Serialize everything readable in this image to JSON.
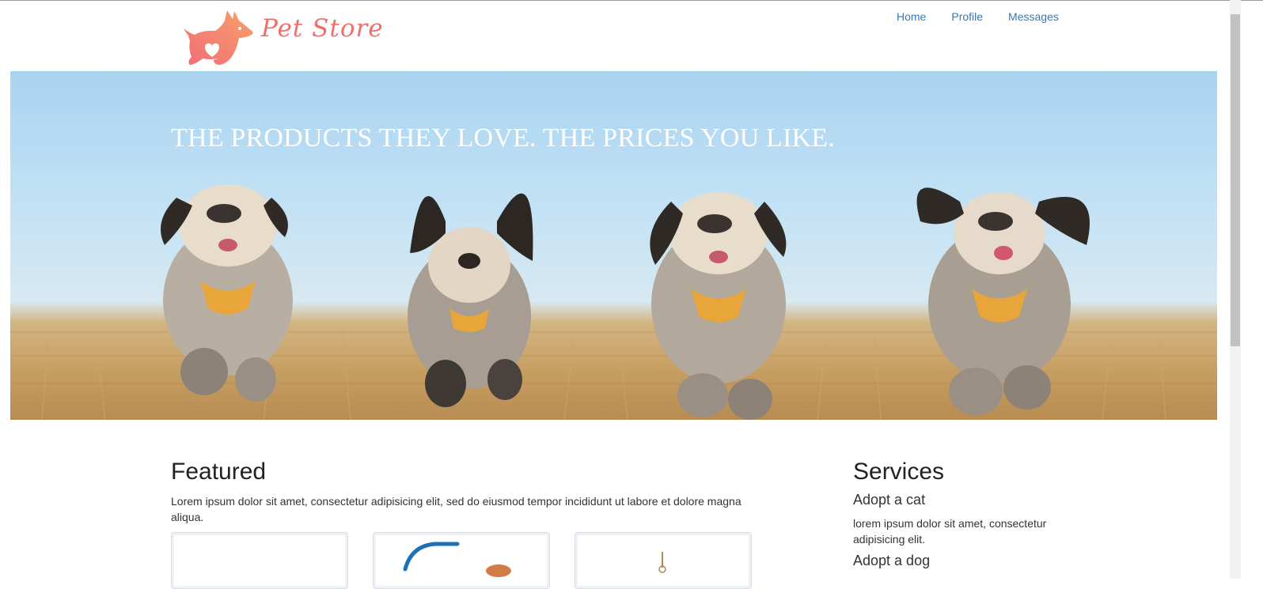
{
  "header": {
    "brand": "Pet Store",
    "nav": [
      "Home",
      "Profile",
      "Messages"
    ]
  },
  "hero": {
    "headline": "THE PRODUCTS THEY LOVE. THE PRICES YOU LIKE."
  },
  "featured": {
    "title": "Featured",
    "text": "Lorem ipsum dolor sit amet, consectetur adipisicing elit, sed do eiusmod tempor incididunt ut labore et dolore magna aliqua."
  },
  "services": {
    "title": "Services",
    "items": [
      {
        "title": "Adopt a cat",
        "text": "lorem ipsum dolor sit amet, consectetur adipisicing elit."
      },
      {
        "title": "Adopt a dog"
      }
    ]
  },
  "colors": {
    "brand": "#ef6f6d",
    "link": "#337ab7"
  }
}
